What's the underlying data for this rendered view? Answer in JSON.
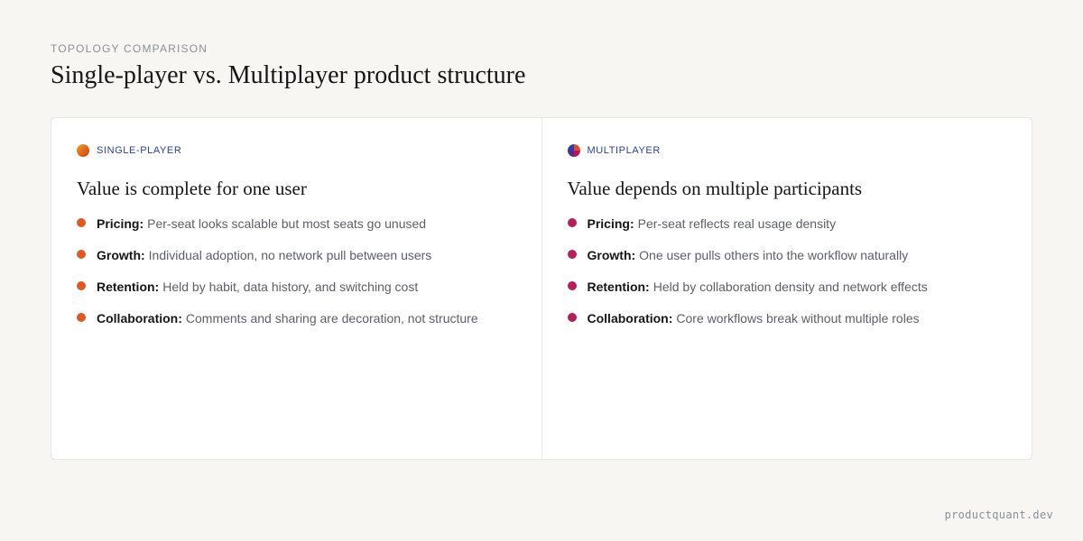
{
  "header": {
    "eyebrow": "TOPOLOGY COMPARISON",
    "title": "Single-player vs. Multiplayer product structure"
  },
  "colors": {
    "background": "#f7f6f2",
    "card": "#ffffff",
    "tag_label": "#2a3f9e",
    "single_bullet": "#e05a1f",
    "multi_bullet": "#b81d5c"
  },
  "panels": [
    {
      "tag": "SINGLE-PLAYER",
      "tag_icon": "orange-gradient-dot-icon",
      "heading": "Value is complete for one user",
      "items": [
        {
          "key": "Pricing:",
          "text": "Per-seat looks scalable but most seats go unused"
        },
        {
          "key": "Growth:",
          "text": "Individual adoption, no network pull between users"
        },
        {
          "key": "Retention:",
          "text": "Held by habit, data history, and switching cost"
        },
        {
          "key": "Collaboration:",
          "text": "Comments and sharing are decoration, not structure"
        }
      ]
    },
    {
      "tag": "MULTIPLAYER",
      "tag_icon": "multicolor-dot-icon",
      "heading": "Value depends on multiple participants",
      "items": [
        {
          "key": "Pricing:",
          "text": "Per-seat reflects real usage density"
        },
        {
          "key": "Growth:",
          "text": "One user pulls others into the workflow naturally"
        },
        {
          "key": "Retention:",
          "text": "Held by collaboration density and network effects"
        },
        {
          "key": "Collaboration:",
          "text": "Core workflows break without multiple roles"
        }
      ]
    }
  ],
  "footer": {
    "domain": "productquant.dev"
  }
}
